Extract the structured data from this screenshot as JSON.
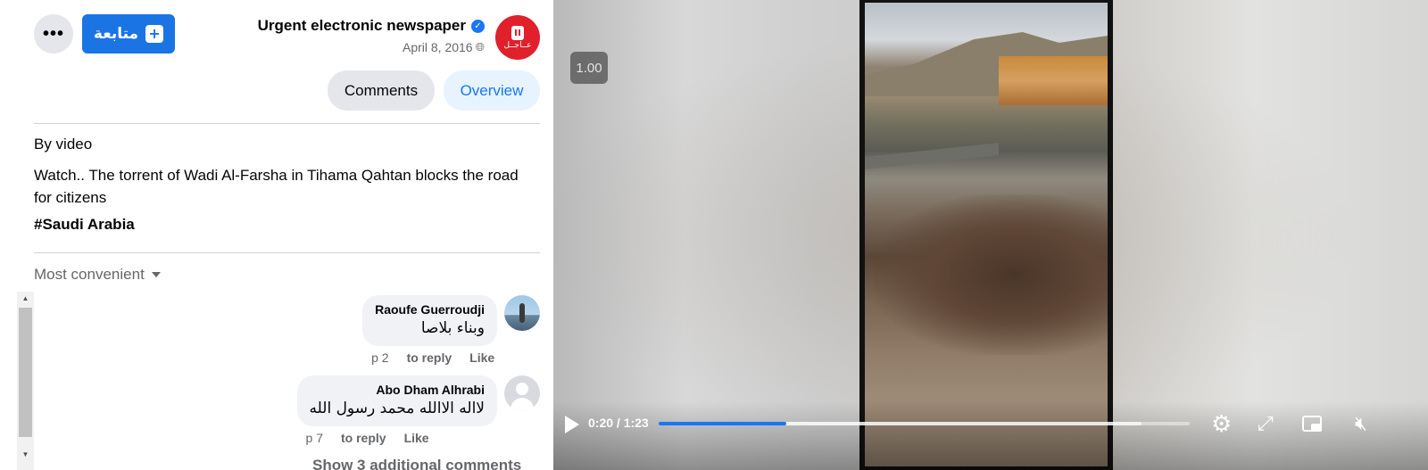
{
  "header": {
    "page_name": "Urgent electronic newspaper",
    "post_date": "April 8, 2016",
    "follow_label": "متابعة",
    "more_label": "•••",
    "avatar_text": "عــاجــل"
  },
  "tabs": [
    {
      "label": "Comments"
    },
    {
      "label": "Overview"
    }
  ],
  "post": {
    "by": "By video",
    "text": "Watch.. The torrent of Wadi Al-Farsha in Tihama Qahtan blocks the road for citizens",
    "hashtag": "#Saudi Arabia"
  },
  "comments_section": {
    "sort_label": "Most convenient",
    "comments": [
      {
        "author": "Raoufe Guerroudji",
        "text": "وبناء بلاصا",
        "time": "p 2",
        "reply": "to reply",
        "like": "Like"
      },
      {
        "author": "Abo Dham Alhrabi",
        "text": "لااله الاالله محمد رسول الله",
        "time": "p 7",
        "reply": "to reply",
        "like": "Like"
      }
    ],
    "more_comments": "Show 3 additional comments"
  },
  "video": {
    "speed": "1.00",
    "time": "0:20 / 1:23",
    "progress": 0.24,
    "buffered": 0.91
  },
  "colors": {
    "accent": "#1877f2",
    "follow_bg": "#1b74e4",
    "avatar_red": "#e0202b"
  },
  "icons": [
    "more-icon",
    "follow-icon",
    "verified-icon",
    "globe-icon",
    "caret-down-icon",
    "play-icon",
    "settings-icon",
    "fullscreen-icon",
    "pip-icon",
    "mute-icon"
  ]
}
